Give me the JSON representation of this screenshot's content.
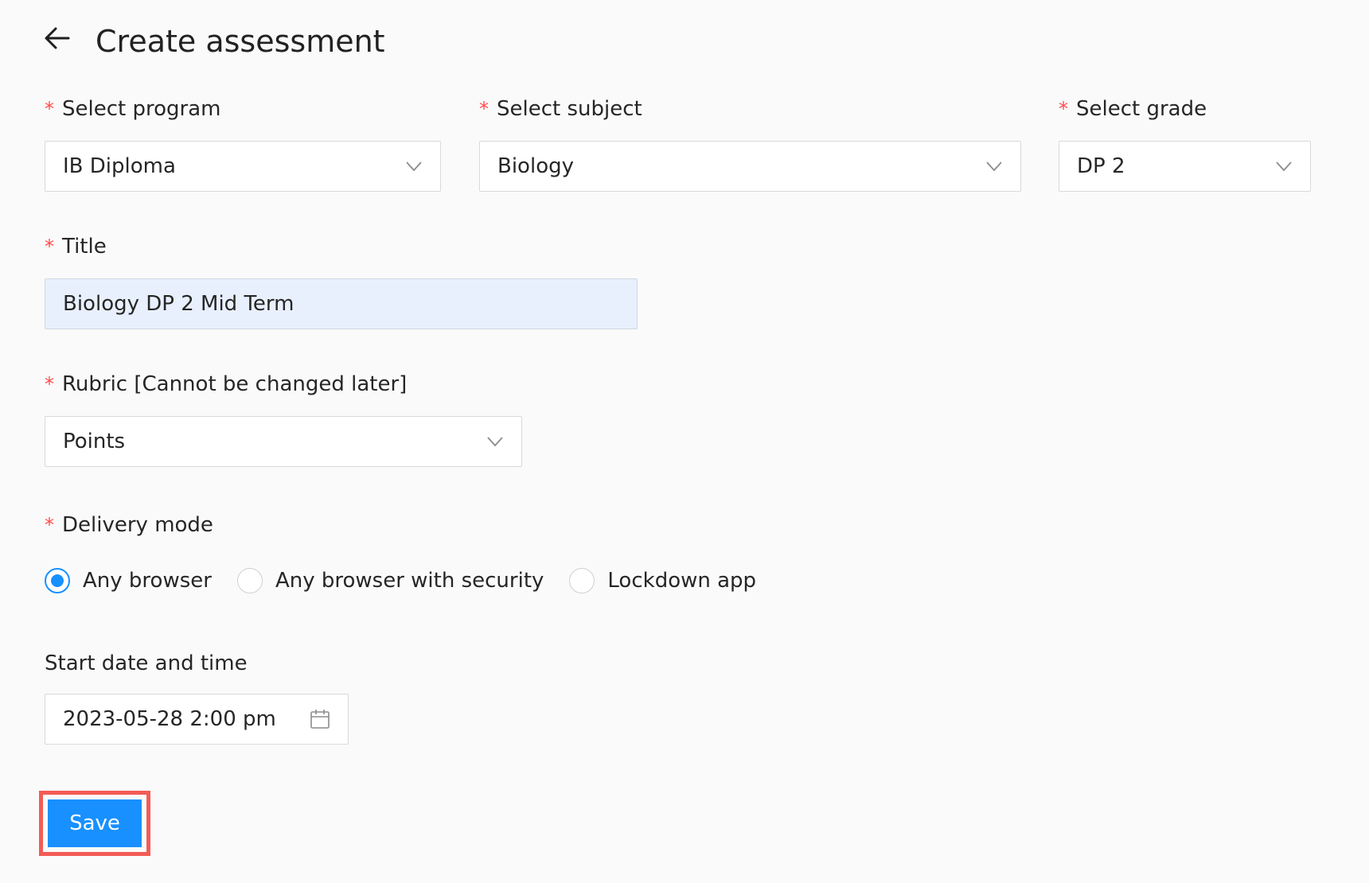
{
  "header": {
    "title": "Create assessment"
  },
  "form": {
    "program": {
      "label": "Select program",
      "value": "IB Diploma"
    },
    "subject": {
      "label": "Select subject",
      "value": "Biology"
    },
    "grade": {
      "label": "Select grade",
      "value": "DP 2"
    },
    "title": {
      "label": "Title",
      "value": "Biology DP 2 Mid Term"
    },
    "rubric": {
      "label": "Rubric [Cannot be changed later]",
      "value": "Points"
    },
    "delivery": {
      "label": "Delivery mode",
      "options": [
        "Any browser",
        "Any browser with security",
        "Lockdown app"
      ],
      "selected": "Any browser"
    },
    "start": {
      "label": "Start date and time",
      "value": "2023-05-28 2:00 pm"
    },
    "required_mark": "*"
  },
  "actions": {
    "save_label": "Save"
  },
  "colors": {
    "accent": "#1890ff",
    "required": "#ff4d4f",
    "highlight": "#f45b55",
    "title_fill": "#e8f0fe"
  },
  "icons": {
    "back": "arrow-left-icon",
    "dropdown": "chevron-down-icon",
    "calendar": "calendar-icon"
  }
}
